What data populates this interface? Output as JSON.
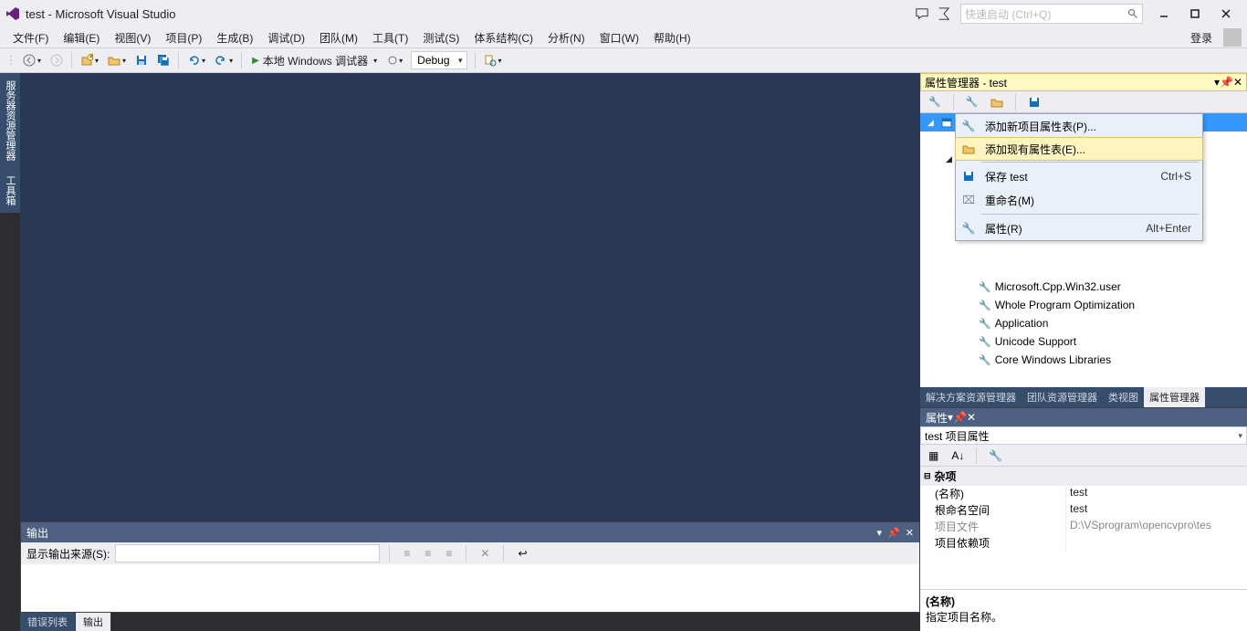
{
  "titlebar": {
    "title": "test - Microsoft Visual Studio",
    "search_placeholder": "快速启动 (Ctrl+Q)"
  },
  "menu": {
    "items": [
      "文件(F)",
      "编辑(E)",
      "视图(V)",
      "项目(P)",
      "生成(B)",
      "调试(D)",
      "团队(M)",
      "工具(T)",
      "测试(S)",
      "体系结构(C)",
      "分析(N)",
      "窗口(W)",
      "帮助(H)"
    ],
    "login": "登录"
  },
  "toolbar": {
    "debugger_label": "本地 Windows 调试器",
    "config": "Debug"
  },
  "sidetabs": [
    "服务器资源管理器",
    "工具箱"
  ],
  "output": {
    "title": "输出",
    "source_label": "显示输出来源(S):"
  },
  "bottom_tabs": {
    "error": "错误列表",
    "output": "输出"
  },
  "propmgr": {
    "title": "属性管理器 - test",
    "context": {
      "add_new": "添加新项目属性表(P)...",
      "add_existing": "添加现有属性表(E)...",
      "save": "保存 test",
      "save_key": "Ctrl+S",
      "rename": "重命名(M)",
      "props": "属性(R)",
      "props_key": "Alt+Enter"
    },
    "leaves": [
      "Microsoft.Cpp.Win32.user",
      "Whole Program Optimization",
      "Application",
      "Unicode Support",
      "Core Windows Libraries"
    ]
  },
  "view_tabs": {
    "sol": "解决方案资源管理器",
    "team": "团队资源管理器",
    "class": "类视图",
    "prop": "属性管理器"
  },
  "props": {
    "title": "属性",
    "combo": "test 项目属性",
    "cat": "杂项",
    "rows": {
      "name_k": "(名称)",
      "name_v": "test",
      "ns_k": "根命名空间",
      "ns_v": "test",
      "file_k": "项目文件",
      "file_v": "D:\\VSprogram\\opencvpro\\tes",
      "dep_k": "项目依赖项",
      "dep_v": ""
    },
    "desc_k": "(名称)",
    "desc_v": "指定项目名称。"
  }
}
